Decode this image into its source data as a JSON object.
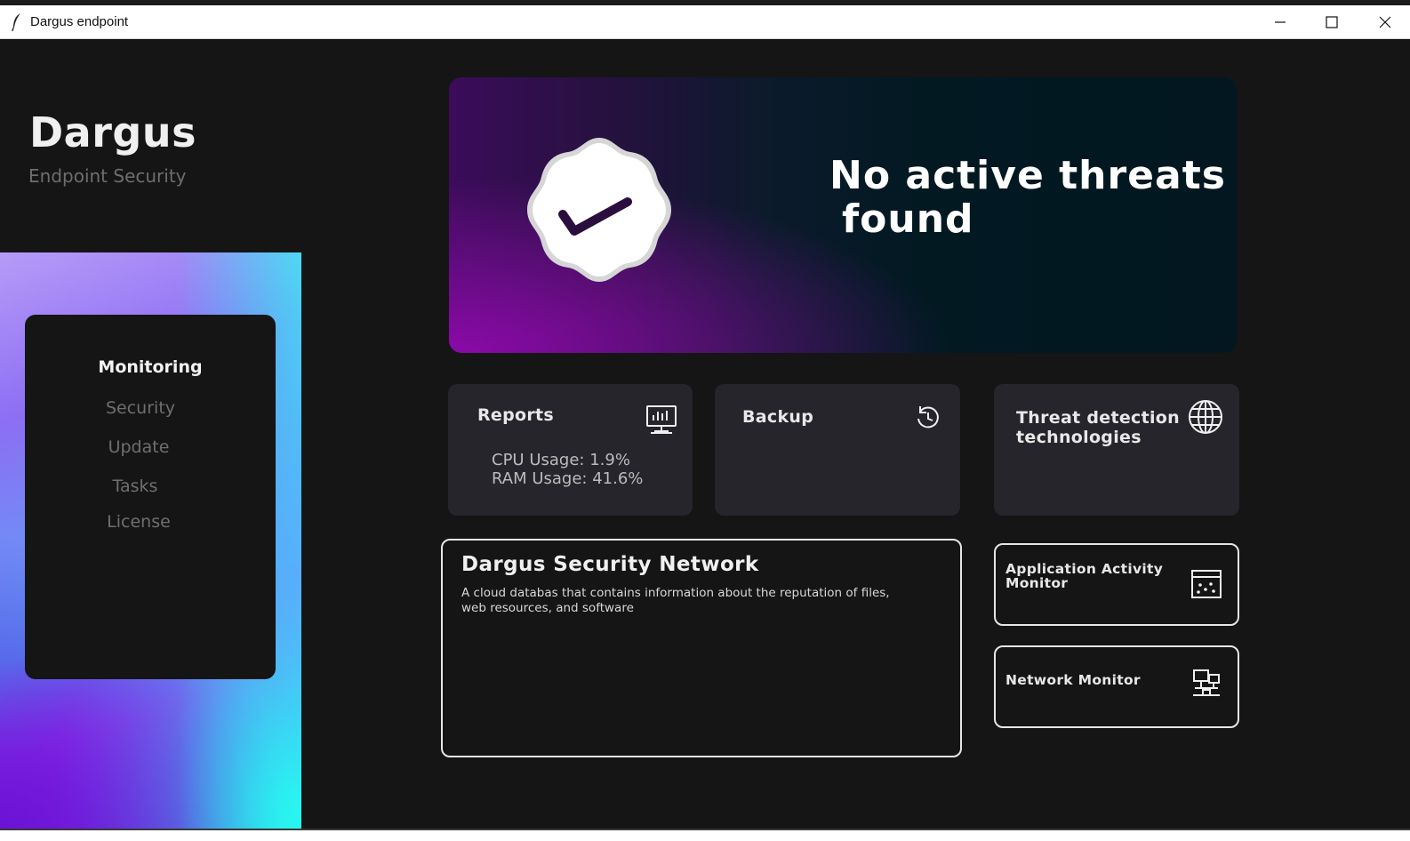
{
  "window": {
    "title": "Dargus endpoint",
    "icon": "feather-icon"
  },
  "brand": {
    "name": "Dargus",
    "subtitle": "Endpoint Security"
  },
  "nav": {
    "items": [
      {
        "label": "Monitoring",
        "active": true
      },
      {
        "label": "Security",
        "active": false
      },
      {
        "label": "Update",
        "active": false
      },
      {
        "label": "Tasks",
        "active": false
      },
      {
        "label": "License",
        "active": false
      }
    ]
  },
  "hero": {
    "line1": "No active threats",
    "line2": "found",
    "icon": "checkmark-badge-icon"
  },
  "cards": {
    "reports": {
      "title": "Reports",
      "icon": "monitor-chart-icon",
      "cpu": "CPU Usage: 1.9%",
      "ram": "RAM Usage: 41.6%"
    },
    "backup": {
      "title": "Backup",
      "icon": "restore-icon"
    },
    "threat": {
      "title_line1": "Threat detection",
      "title_line2": "technologies",
      "icon": "globe-icon"
    }
  },
  "network": {
    "title": "Dargus Security Network",
    "description": "A cloud databas that contains information about the reputation of files, web resources, and software"
  },
  "monitors": {
    "app_activity": {
      "title_line1": "Application Activity",
      "title_line2": "Monitor",
      "icon": "app-window-icon"
    },
    "network_monitor": {
      "title": "Network Monitor",
      "icon": "network-icon"
    }
  },
  "colors": {
    "background": "#151515",
    "card": "#25252b",
    "accent_purple": "#8b0aa8",
    "accent_cyan": "#25fbf2"
  }
}
